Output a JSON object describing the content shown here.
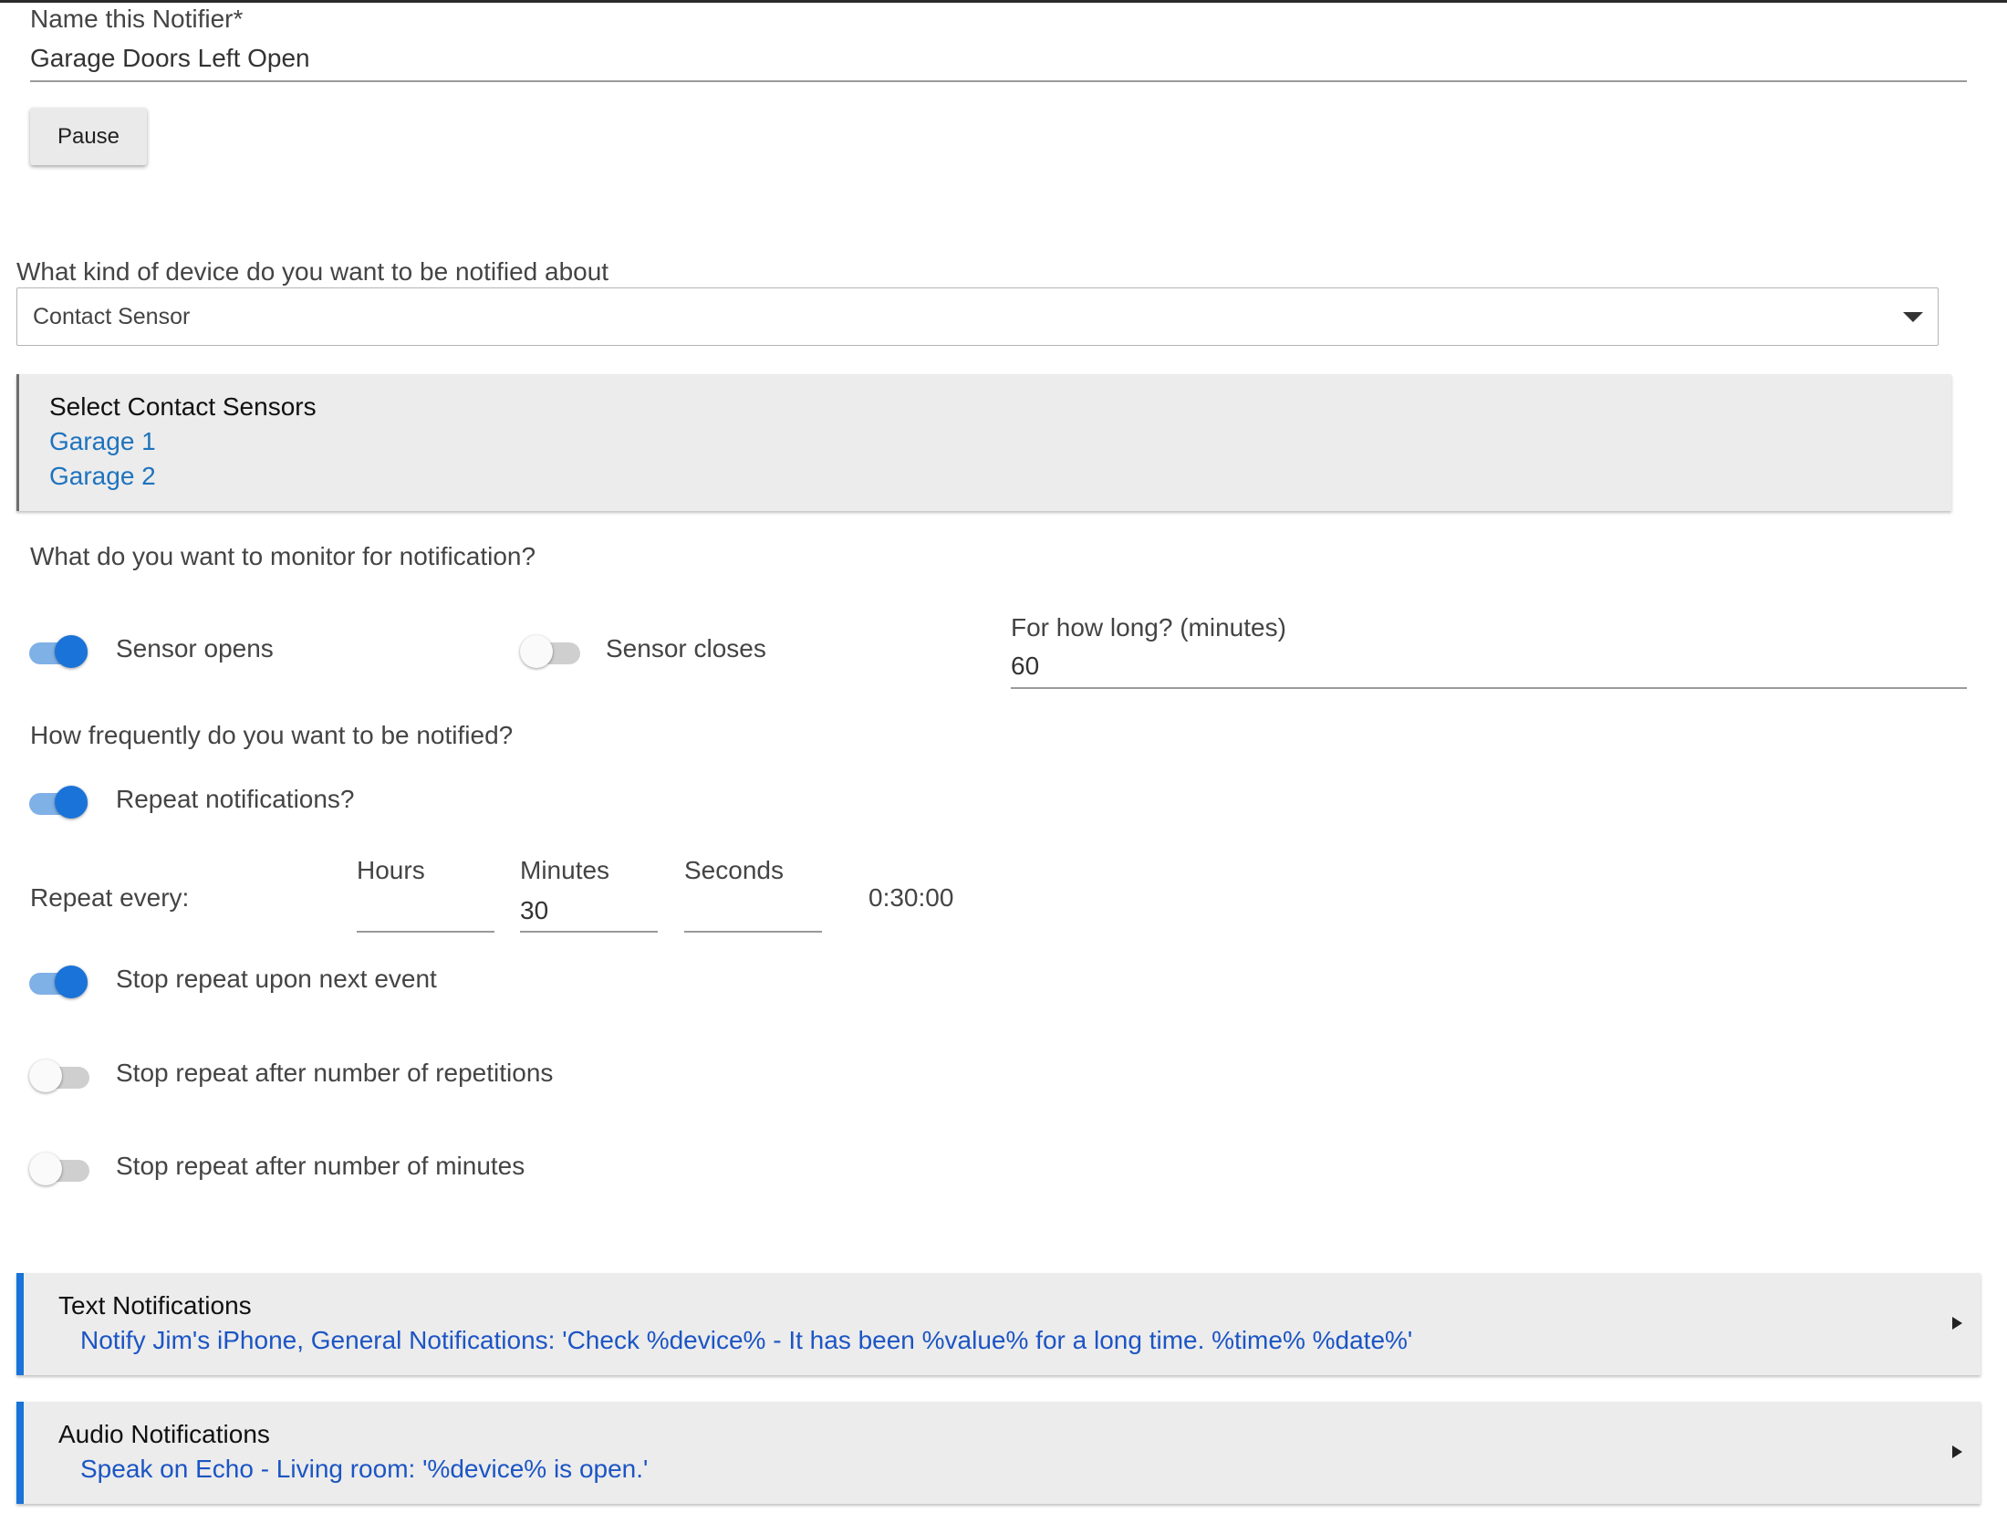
{
  "name_field": {
    "label": "Name this Notifier*",
    "value": "Garage Doors Left Open"
  },
  "pause_button": {
    "label": "Pause"
  },
  "device_kind": {
    "label": "What kind of device do you want to be notified about",
    "selected": "Contact Sensor"
  },
  "sensor_select": {
    "title": "Select Contact Sensors",
    "devices": [
      "Garage 1",
      "Garage 2"
    ]
  },
  "monitor": {
    "question": "What do you want to monitor for notification?",
    "sensor_opens": {
      "label": "Sensor opens",
      "on": true
    },
    "sensor_closes": {
      "label": "Sensor closes",
      "on": false
    },
    "duration": {
      "label": "For how long? (minutes)",
      "value": "60"
    }
  },
  "frequency": {
    "question": "How frequently do you want to be notified?",
    "repeat": {
      "label": "Repeat notifications?",
      "on": true
    },
    "repeat_every": {
      "label": "Repeat every:",
      "hours": {
        "label": "Hours",
        "value": ""
      },
      "minutes": {
        "label": "Minutes",
        "value": "30"
      },
      "seconds": {
        "label": "Seconds",
        "value": ""
      },
      "total": "0:30:00"
    },
    "stop_next_event": {
      "label": "Stop repeat upon next event",
      "on": true
    },
    "stop_repetitions": {
      "label": "Stop repeat after number of repetitions",
      "on": false
    },
    "stop_minutes": {
      "label": "Stop repeat after number of minutes",
      "on": false
    }
  },
  "text_notifications": {
    "title": "Text Notifications",
    "description": "Notify Jim's iPhone, General Notifications: 'Check %device% - It has been %value% for a long time. %time% %date%'"
  },
  "audio_notifications": {
    "title": "Audio Notifications",
    "description": "Speak on Echo - Living room: '%device% is open.'"
  },
  "colors": {
    "accent": "#1a73d9",
    "link": "#1e73be",
    "panel_bg": "#ececec"
  }
}
